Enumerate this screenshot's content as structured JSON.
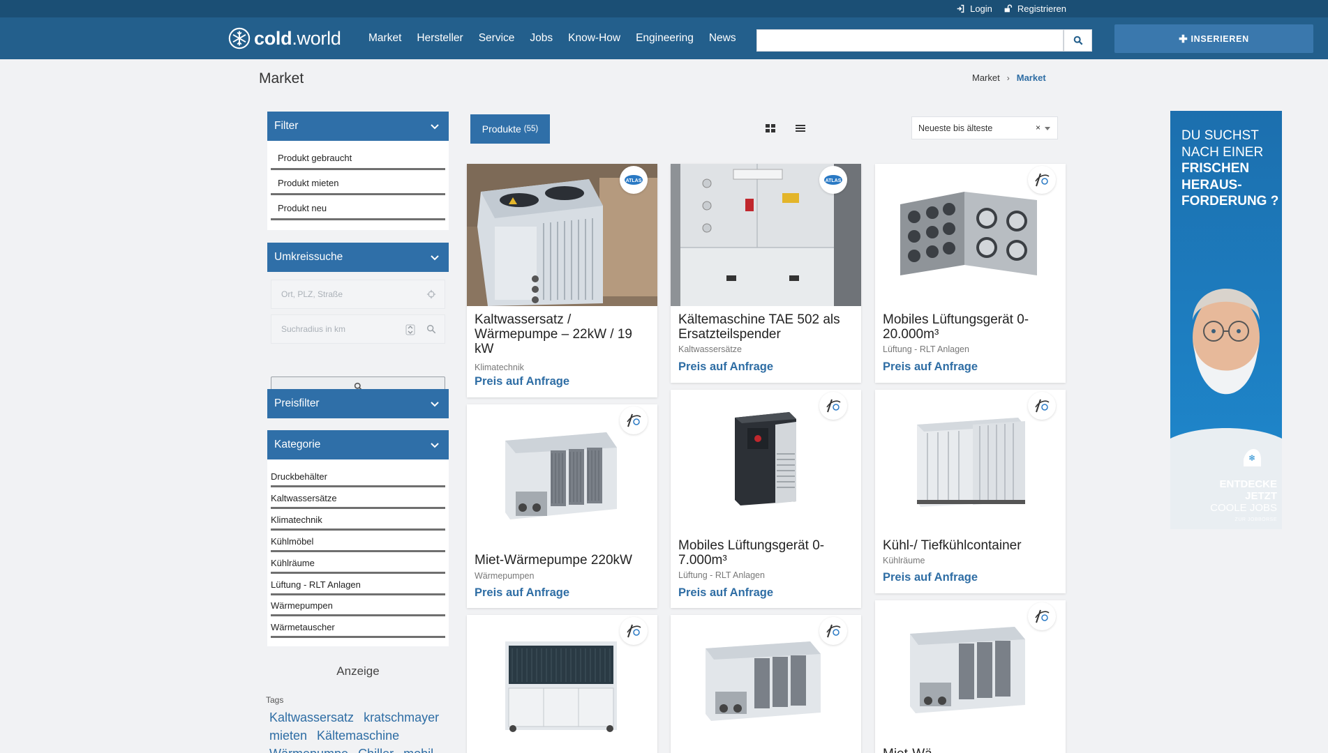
{
  "topbar": {
    "login": "Login",
    "register": "Registrieren"
  },
  "brand": {
    "name_bold": "cold",
    "name_rest": ".world"
  },
  "nav": [
    "Market",
    "Hersteller",
    "Service",
    "Jobs",
    "Know-How",
    "Engineering",
    "News"
  ],
  "search": {
    "placeholder": "",
    "value": ""
  },
  "insert_button": "INSERIEREN",
  "page_title": "Market",
  "breadcrumb": {
    "parent": "Market",
    "current": "Market"
  },
  "sidebar": {
    "filter": {
      "title": "Filter",
      "items": [
        "Produkt gebraucht",
        "Produkt mieten",
        "Produkt neu"
      ]
    },
    "radius": {
      "title": "Umkreissuche",
      "location_placeholder": "Ort, PLZ, Straße",
      "radius_placeholder": "Suchradius in km"
    },
    "price": {
      "title": "Preisfilter"
    },
    "category": {
      "title": "Kategorie",
      "items": [
        "Druckbehälter",
        "Kaltwassersätze",
        "Klimatechnik",
        "Kühlmöbel",
        "Kühlräume",
        "Lüftung - RLT Anlagen",
        "Wärmepumpen",
        "Wärmetauscher"
      ]
    },
    "ad_label": "Anzeige",
    "tags_label": "Tags",
    "tags": [
      "Kaltwassersatz",
      "kratschmayer",
      "mieten",
      "Kältemaschine",
      "Wärmepumpe",
      "Chiller",
      "mobil"
    ]
  },
  "toolbar": {
    "products_label": "Produkte",
    "products_count": "(55)",
    "sort": {
      "selected": "Neueste bis älteste",
      "clear": "×"
    }
  },
  "products": [
    {
      "title": "Kaltwassersatz / Wärmepumpe – 22kW / 19 kW",
      "category": "Klimatechnik",
      "price": "Preis auf Anfrage",
      "badge": "atlas-logo",
      "image": "outdoor-chiller-photo"
    },
    {
      "title": "Kältemaschine TAE 502 als Ersatzteilspender",
      "category": "Kaltwassersätze",
      "price": "Preis auf Anfrage",
      "badge": "atlas-logo",
      "image": "indoor-chiller-photo"
    },
    {
      "title": "Mobiles Lüftungsgerät 0-20.000m³",
      "category": "Lüftung - RLT Anlagen",
      "price": "Preis auf Anfrage",
      "badge": "kratschmayer-logo",
      "image": "ventilation-unit"
    },
    {
      "title": "Miet-Wärmepumpe 220kW",
      "category": "Wärmepumpen",
      "price": "Preis auf Anfrage",
      "badge": "kratschmayer-logo",
      "image": "heat-pump-unit"
    },
    {
      "title": "Mobiles Lüftungsgerät 0-7.000m³",
      "category": "Lüftung - RLT Anlagen",
      "price": "Preis auf Anfrage",
      "badge": "kratschmayer-logo",
      "image": "dark-ventilation-unit"
    },
    {
      "title": "Kühl-/ Tiefkühlcontainer",
      "category": "Kühlräume",
      "price": "Preis auf Anfrage",
      "badge": "kratschmayer-logo",
      "image": "cold-container"
    },
    {
      "title": "",
      "category": "",
      "price": "",
      "badge": "kratschmayer-logo",
      "image": "chiller-unit"
    },
    {
      "title": "",
      "category": "",
      "price": "",
      "badge": "kratschmayer-logo",
      "image": "chiller-unit"
    },
    {
      "title": "Miet-Wä...",
      "category": "",
      "price": "",
      "badge": "kratschmayer-logo",
      "image": "chiller-unit"
    }
  ],
  "ad": {
    "headline_1": "DU SUCHST",
    "headline_2": "NACH EINER",
    "headline_3": "FRISCHEN",
    "headline_4": "HERAUS-",
    "headline_5": "FORDERUNG ?",
    "cta_1": "ENTDECKE",
    "cta_2": "JETZT",
    "cta_3": "COOLE JOBS",
    "cta_small": "ZUR JOBBÖRSE"
  },
  "colors": {
    "topbar": "#1b4f75",
    "navbar": "#235f8c",
    "accent": "#2f6fa8",
    "link": "#2e6da4",
    "page_bg": "#f1f2f4"
  }
}
